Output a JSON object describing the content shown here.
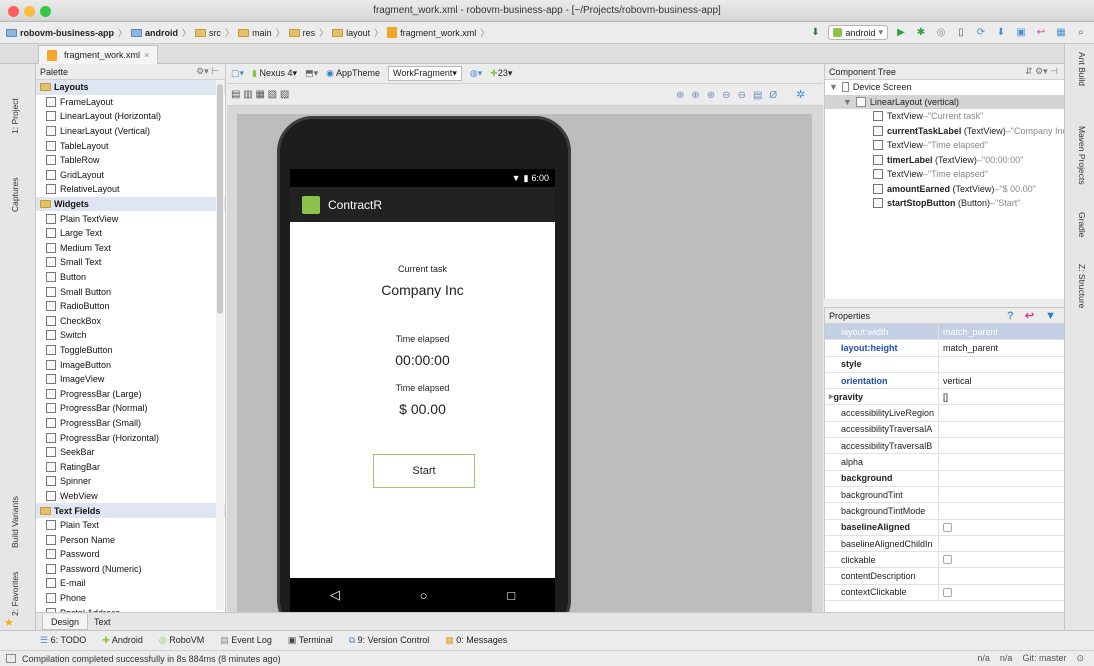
{
  "window": {
    "title": "fragment_work.xml - robovm-business-app - [~/Projects/robovm-business-app]"
  },
  "breadcrumb": [
    "robovm-business-app",
    "android",
    "src",
    "main",
    "res",
    "layout",
    "fragment_work.xml"
  ],
  "toolbar": {
    "run_config": "android"
  },
  "editor_tab": {
    "label": "fragment_work.xml"
  },
  "left_strip": {
    "project": "1: Project",
    "captures": "Captures",
    "build_variants": "Build Variants",
    "favorites": "2: Favorites"
  },
  "right_strip": {
    "ant": "Ant Build",
    "maven": "Maven Projects",
    "gradle": "Gradle",
    "structure": "Z: Structure"
  },
  "palette": {
    "title": "Palette",
    "categories": [
      {
        "name": "Layouts",
        "items": [
          "FrameLayout",
          "LinearLayout (Horizontal)",
          "LinearLayout (Vertical)",
          "TableLayout",
          "TableRow",
          "GridLayout",
          "RelativeLayout"
        ]
      },
      {
        "name": "Widgets",
        "items": [
          "Plain TextView",
          "Large Text",
          "Medium Text",
          "Small Text",
          "Button",
          "Small Button",
          "RadioButton",
          "CheckBox",
          "Switch",
          "ToggleButton",
          "ImageButton",
          "ImageView",
          "ProgressBar (Large)",
          "ProgressBar (Normal)",
          "ProgressBar (Small)",
          "ProgressBar (Horizontal)",
          "SeekBar",
          "RatingBar",
          "Spinner",
          "WebView"
        ]
      },
      {
        "name": "Text Fields",
        "items": [
          "Plain Text",
          "Person Name",
          "Password",
          "Password (Numeric)",
          "E-mail",
          "Phone",
          "Postal Address"
        ]
      }
    ]
  },
  "design_toolbar": {
    "device": "Nexus 4",
    "theme": "AppTheme",
    "activity": "WorkFragment",
    "api": "23"
  },
  "phone": {
    "time": "6:00",
    "app_title": "ContractR",
    "current_task_label": "Current task",
    "current_task_value": "Company Inc",
    "time_elapsed_label": "Time elapsed",
    "timer_value": "00:00:00",
    "time_elapsed_label2": "Time elapsed",
    "amount_value": "$ 00.00",
    "start_button": "Start",
    "nav_back": "◁",
    "nav_home": "○",
    "nav_recent": "□"
  },
  "component_tree": {
    "title": "Component Tree",
    "device_screen": "Device Screen",
    "root": "LinearLayout (vertical)",
    "children": [
      {
        "id": "",
        "type": "TextView",
        "text": "\"Current task\""
      },
      {
        "id": "currentTaskLabel",
        "type": "(TextView)",
        "text": "\"Company Inc\""
      },
      {
        "id": "",
        "type": "TextView",
        "text": "\"Time elapsed\""
      },
      {
        "id": "timerLabel",
        "type": "(TextView)",
        "text": "\"00:00:00\""
      },
      {
        "id": "",
        "type": "TextView",
        "text": "\"Time elapsed\""
      },
      {
        "id": "amountEarned",
        "type": "(TextView)",
        "text": "\"$ 00.00\""
      },
      {
        "id": "startStopButton",
        "type": "(Button)",
        "text": "\"Start\""
      }
    ]
  },
  "properties": {
    "title": "Properties",
    "rows": [
      {
        "key": "layout:width",
        "value": "match_parent",
        "style": "blue"
      },
      {
        "key": "layout:height",
        "value": "match_parent",
        "style": "blue"
      },
      {
        "key": "style",
        "value": "",
        "style": "bold"
      },
      {
        "key": "orientation",
        "value": "vertical",
        "style": "blue"
      },
      {
        "key": "gravity",
        "value": "[]",
        "style": "bold"
      },
      {
        "key": "accessibilityLiveRegion",
        "value": "",
        "style": ""
      },
      {
        "key": "accessibilityTraversalA",
        "value": "",
        "style": ""
      },
      {
        "key": "accessibilityTraversalB",
        "value": "",
        "style": ""
      },
      {
        "key": "alpha",
        "value": "",
        "style": ""
      },
      {
        "key": "background",
        "value": "",
        "style": "bold"
      },
      {
        "key": "backgroundTint",
        "value": "",
        "style": ""
      },
      {
        "key": "backgroundTintMode",
        "value": "",
        "style": ""
      },
      {
        "key": "baselineAligned",
        "value": "checkbox",
        "style": "bold"
      },
      {
        "key": "baselineAlignedChildIn",
        "value": "",
        "style": ""
      },
      {
        "key": "clickable",
        "value": "checkbox",
        "style": ""
      },
      {
        "key": "contentDescription",
        "value": "",
        "style": ""
      },
      {
        "key": "contextClickable",
        "value": "checkbox",
        "style": ""
      }
    ]
  },
  "bottom_tabs": [
    "Design",
    "Text"
  ],
  "tool_windows": [
    "6: TODO",
    "Android",
    "RoboVM",
    "Event Log",
    "Terminal",
    "9: Version Control",
    "0: Messages"
  ],
  "status": {
    "message": "Compilation completed successfully in 8s 884ms (8 minutes ago)",
    "pos1": "n/a",
    "pos2": "n/a",
    "git": "Git: master"
  },
  "colors": {
    "accent": "#8bc34a",
    "selection": "#c3d0e4"
  }
}
